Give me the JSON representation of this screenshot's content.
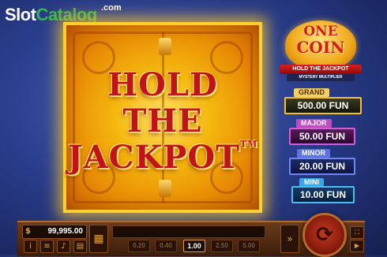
{
  "watermark": {
    "part1": "Slot",
    "part2": "Catalog",
    "suffix": ".com"
  },
  "door": {
    "headline_line1": "HOLD",
    "headline_line2": "THE",
    "headline_line3": "JACKPOT",
    "trademark": "TM"
  },
  "logo": {
    "line1": "ONE",
    "line2": "COIN",
    "ribbon": "HOLD THE JACKPOT",
    "subtitle": "MYSTERY MULTIPLIER"
  },
  "jackpots": [
    {
      "label": "GRAND",
      "value": "500.00 FUN",
      "color": "#f0c232"
    },
    {
      "label": "MAJOR",
      "value": "50.00 FUN",
      "color": "#d65bd8"
    },
    {
      "label": "MINOR",
      "value": "20.00 FUN",
      "color": "#6d86f2"
    },
    {
      "label": "MINI",
      "value": "10.00 FUN",
      "color": "#4bbdf5"
    }
  ],
  "controls": {
    "balance": "99,995.00",
    "balance_icon": "money-bag-icon",
    "bet_options": [
      "0.20",
      "0.40",
      "1.00",
      "2.50",
      "5.00"
    ],
    "selected_bet": "1.00",
    "icons": {
      "info": "info-icon",
      "menu": "menu-icon",
      "sound": "sound-icon",
      "bet_menu": "bet-menu-icon",
      "autoplay": "autoplay-icon",
      "spin": "spin-icon",
      "fullscreen": "fullscreen-icon",
      "turbo": "turbo-icon"
    }
  },
  "colors": {
    "background": "#2b3f8f",
    "door_gold": "#f5b80e",
    "headline_red": "#c0141a",
    "bar_brown": "#6b3a1a"
  }
}
